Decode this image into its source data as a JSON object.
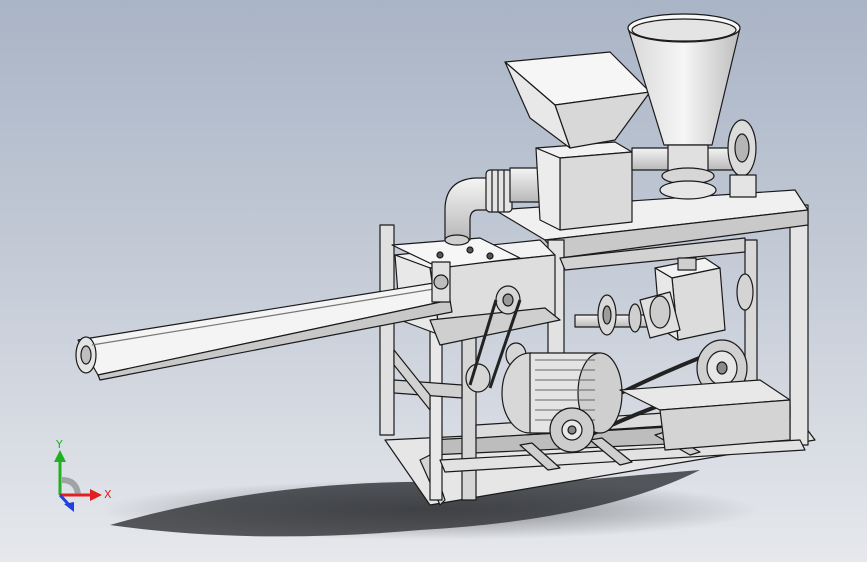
{
  "viewport": {
    "background_top": "#a9b4c6",
    "background_bottom": "#e6e8ec",
    "model_fill": "#ececec",
    "model_shadow": "#cfd2d6",
    "model_edge": "#1a1a1a",
    "ground_shadow": "#3a3c40"
  },
  "triad": {
    "x_label": "X",
    "y_label": "Y",
    "x_color": "#e02020",
    "y_color": "#20b020",
    "z_color": "#2040e0"
  },
  "model": {
    "parts": [
      "hopper-rectangular",
      "hopper-conical",
      "extruder-elbow-pipe",
      "conveyor-belt",
      "electric-motor",
      "gearbox",
      "pulleys",
      "frame"
    ]
  }
}
